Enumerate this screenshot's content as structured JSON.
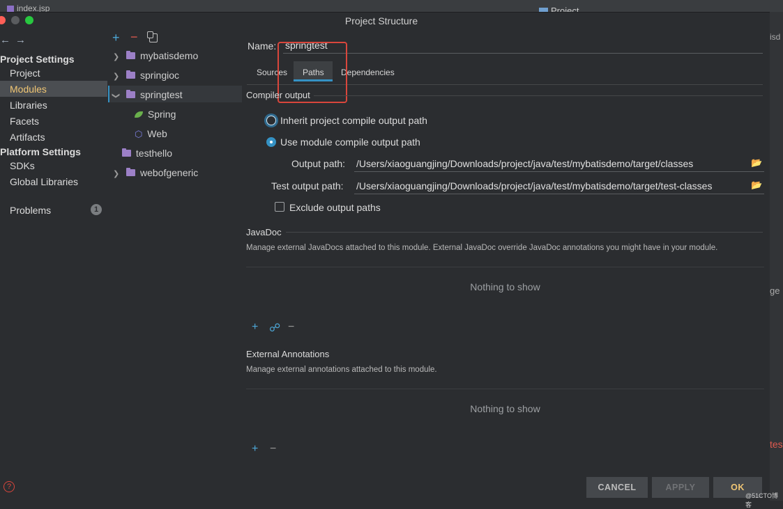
{
  "background": {
    "tab_label": "index.jsp",
    "project_label": "Project",
    "right_fragments": [
      "isd",
      "ge",
      "tes"
    ]
  },
  "window": {
    "title": "Project Structure"
  },
  "sidebar": {
    "project_settings_heading": "Project Settings",
    "project_items": [
      "Project",
      "Modules",
      "Libraries",
      "Facets",
      "Artifacts"
    ],
    "selected": "Modules",
    "platform_settings_heading": "Platform Settings",
    "platform_items": [
      "SDKs",
      "Global Libraries"
    ],
    "problems_label": "Problems",
    "problems_count": "1"
  },
  "module_tree": {
    "items": [
      {
        "label": "mybatisdemo",
        "expandable": true
      },
      {
        "label": "springioc",
        "expandable": true
      },
      {
        "label": "springtest",
        "expanded": true,
        "selected": true
      },
      {
        "label": "Spring",
        "child": true,
        "icon": "spring-leaf-icon"
      },
      {
        "label": "Web",
        "child": true,
        "icon": "web-hex-icon"
      },
      {
        "label": "testhello",
        "expandable": false
      },
      {
        "label": "webofgeneric",
        "expandable": true
      }
    ]
  },
  "module": {
    "name_label": "Name:",
    "name_value": "springtest",
    "tabs": [
      "Sources",
      "Paths",
      "Dependencies"
    ],
    "active_tab": "Paths"
  },
  "compiler_output": {
    "heading": "Compiler output",
    "inherit_label": "Inherit project compile output path",
    "use_module_label": "Use module compile output path",
    "output_path_label": "Output path:",
    "output_path_value": "/Users/xiaoguangjing/Downloads/project/java/test/mybatisdemo/target/classes",
    "test_output_path_label": "Test output path:",
    "test_output_path_value": "/Users/xiaoguangjing/Downloads/project/java/test/mybatisdemo/target/test-classes",
    "exclude_label": "Exclude output paths"
  },
  "javadoc": {
    "heading": "JavaDoc",
    "description": "Manage external JavaDocs attached to this module. External JavaDoc override JavaDoc annotations you might have in your module.",
    "empty_text": "Nothing to show"
  },
  "external_annotations": {
    "heading": "External Annotations",
    "description": "Manage external annotations attached to this module.",
    "empty_text": "Nothing to show"
  },
  "footer": {
    "cancel": "CANCEL",
    "apply": "APPLY",
    "ok": "OK",
    "help_glyph": "?",
    "watermark": "@51CTO博客"
  },
  "colors": {
    "accent": "#3592c4",
    "highlight_box": "#d9463c",
    "selected_text": "#f0c674"
  }
}
